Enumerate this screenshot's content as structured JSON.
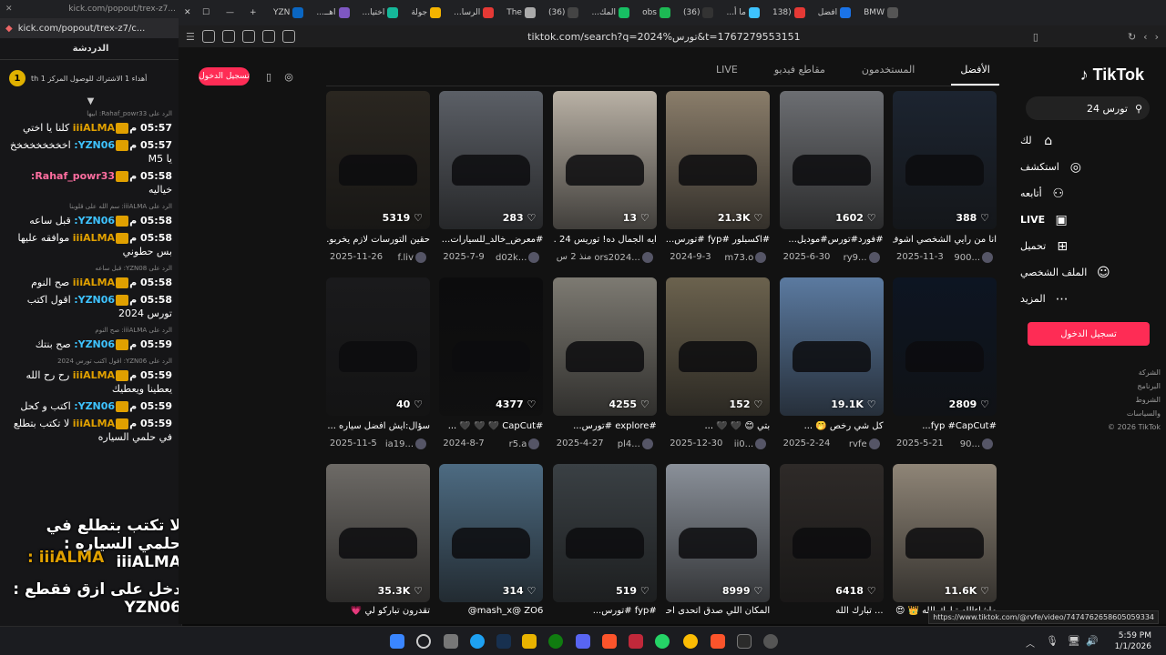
{
  "left_popout": {
    "url": "kick.com/popout/trex-z7/c...",
    "url_top": "kick.com/popout/trex-z7...",
    "title": "الدردشة",
    "pinned": "أهداء 1 الاشتراك للوصول المركز 1 th",
    "pinned_badge": "1",
    "messages": [
      {
        "reply": "الرد على Rahaf_powr33: ابيها",
        "time": "05:57 م",
        "user": "iiiALMA",
        "user_color": "#e0a000",
        "text": "كلنا يا اختي"
      },
      {
        "reply": "",
        "time": "05:57 م",
        "user": "YZN06:",
        "user_color": "#3ec3ff",
        "text": "اخخخخخخخخخ يا M5"
      },
      {
        "reply": "",
        "time": "05:58 م",
        "user": "Rahaf_powr33:",
        "user_color": "#ff6ea0",
        "text": "خياليه"
      },
      {
        "reply": "الرد على iiiALMA: سم الله على قلوبنا",
        "time": "05:58 م",
        "user": "YZN06:",
        "user_color": "#3ec3ff",
        "text": "قبل ساعه"
      },
      {
        "reply": "",
        "time": "05:58 م",
        "user": "iiiALMA",
        "user_color": "#e0a000",
        "text": "موافقه عليها بس حطوني"
      },
      {
        "reply": "الرد على YZN08: قبل ساعه",
        "time": "05:58 م",
        "user": "iiiALMA",
        "user_color": "#e0a000",
        "text": "صح النوم"
      },
      {
        "reply": "",
        "time": "05:58 م",
        "user": "YZN06:",
        "user_color": "#3ec3ff",
        "text": "اقول اكتب تورس 2024"
      },
      {
        "reply": "الرد على iiiALMA: صح النوم",
        "time": "05:59 م",
        "user": "YZN06:",
        "user_color": "#3ec3ff",
        "text": "صح بنتك"
      },
      {
        "reply": "الرد على YZN06: اقول اكتب تورس 2024",
        "time": "05:59 م",
        "user": "iiiALMA",
        "user_color": "#e0a000",
        "text": "رح رح الله يعطينا ويعطيك"
      },
      {
        "reply": "",
        "time": "05:59 م",
        "user": "YZN06:",
        "user_color": "#3ec3ff",
        "text": "اكتب و كحل"
      },
      {
        "reply": "",
        "time": "05:59 م",
        "user": "iiiALMA",
        "user_color": "#e0a000",
        "text": "لا تكتب بتطلع في حلمي السياره"
      },
      {
        "reply": "",
        "time": "05:59 م",
        "user": "iiiALMA",
        "user_color": "#e0a000",
        "text": ""
      }
    ],
    "overlay1": "لا تكتب بتطلع في حلمي السياره : iiiALMA",
    "overlay1_side": "دخل على",
    "overlay2_user": "iiiALMA :",
    "overlay3": "دخل على ازق فقطع : YZN06"
  },
  "browser": {
    "tabs": [
      "BMW",
      "افضل",
      "(138",
      "ما أ...",
      "(36)",
      "obs",
      "المك...",
      "(36)",
      "The",
      "الرسا...",
      "جولة",
      "اختيا...",
      "اهــ...",
      "YZN"
    ],
    "url": "tiktok.com/search?q=2024%تورس&t=1767279553151"
  },
  "tiktok": {
    "logo": "TikTok",
    "search_value": "تورس 24",
    "nav": [
      {
        "label": "لك",
        "icon": "home-icon"
      },
      {
        "label": "استكشف",
        "icon": "compass-icon"
      },
      {
        "label": "أتابعه",
        "icon": "user-follow-icon"
      },
      {
        "label": "LIVE",
        "icon": "live-icon"
      },
      {
        "label": "تحميل",
        "icon": "upload-icon"
      },
      {
        "label": "الملف الشخصي",
        "icon": "profile-icon"
      },
      {
        "label": "المزيد",
        "icon": "more-icon"
      }
    ],
    "login_button": "تسجيل الدخول",
    "top_login": "تسجيل الدخول",
    "footer": [
      "الشركة",
      "البرنامج",
      "الشروط والسياسات",
      "© 2026 TikTok"
    ],
    "tabs": [
      "الأفضل",
      "المستخدمون",
      "مقاطع فيديو",
      "LIVE"
    ],
    "videos": [
      {
        "likes": "388",
        "caption": "انا من رأيي الشخصي اشوف...",
        "date": "2025-11-3",
        "user": "900...",
        "color": "#1c2430"
      },
      {
        "likes": "1602",
        "caption": "#فورد#تورس#موديل...",
        "date": "2025-6-30",
        "user": "ry9...",
        "color": "#6c6e72"
      },
      {
        "likes": "21.3K",
        "caption": "#اكسبلور #fyp #تورس...",
        "date": "2024-9-3",
        "user": "m73.o",
        "color": "#8a7d6a"
      },
      {
        "likes": "13",
        "caption": "ايه الجمال ده! توريس 24 ...",
        "date": "منذ 2 س",
        "user": "ors2024...",
        "color": "#b9b1a5"
      },
      {
        "likes": "283",
        "caption": "#معرض_خالد_للسيارات...",
        "date": "2025-7-9",
        "user": "d02k...",
        "color": "#5b5f66"
      },
      {
        "likes": "5319",
        "caption": "حقين التورسات لازم يخربو...",
        "date": "2025-11-26",
        "user": "f.liv",
        "color": "#2a2620"
      },
      {
        "likes": "2809",
        "caption": "#fyp #CapCut...",
        "date": "2025-5-21",
        "user": "90...",
        "color": "#0d1522"
      },
      {
        "likes": "19.1K",
        "caption": "كل شي رخص 🤭 ...",
        "date": "2025-2-24",
        "user": "rvfe",
        "color": "#5b7aa0"
      },
      {
        "likes": "152",
        "caption": "بتي 😊 🖤 🖤 ...",
        "date": "2025-12-30",
        "user": "ii0...",
        "color": "#6b624e"
      },
      {
        "likes": "4255",
        "caption": "#explore #تورس...",
        "date": "2025-4-27",
        "user": "pl4...",
        "color": "#7d7a72"
      },
      {
        "likes": "4377",
        "caption": "#CapCut 🖤 🖤 🖤 ...",
        "date": "2024-8-7",
        "user": "r5.a",
        "color": "#0c0c0d"
      },
      {
        "likes": "40",
        "caption": "سؤال:ايش افضل سياره ...",
        "date": "2025-11-5",
        "user": "ia19...",
        "color": "#1a1a1c"
      },
      {
        "likes": "11.6K",
        "caption": "ماشاءالله تبارك الله 👑 😍",
        "date": "",
        "user": "",
        "color": "#8f8577"
      },
      {
        "likes": "6418",
        "caption": "... تبارك الله",
        "date": "",
        "user": "",
        "color": "#2e2a28"
      },
      {
        "likes": "8999",
        "caption": "المكان اللي صدق اتحدى احد...",
        "date": "",
        "user": "",
        "color": "#8a9099"
      },
      {
        "likes": "519",
        "caption": "#fyp #تورس...",
        "date": "",
        "user": "",
        "color": "#3a4044"
      },
      {
        "likes": "314",
        "caption": "mash_x@ ZO6@",
        "date": "",
        "user": "",
        "color": "#4d6b82"
      },
      {
        "likes": "35.3K",
        "caption": "تقدرون تباركو لي 💗",
        "date": "",
        "user": "",
        "color": "#6d6a66"
      }
    ],
    "status_url": "https://www.tiktok.com/@rvfe/video/7474762658605059334"
  },
  "taskbar": {
    "time": "5:59 PM",
    "date": "1/1/2026"
  }
}
